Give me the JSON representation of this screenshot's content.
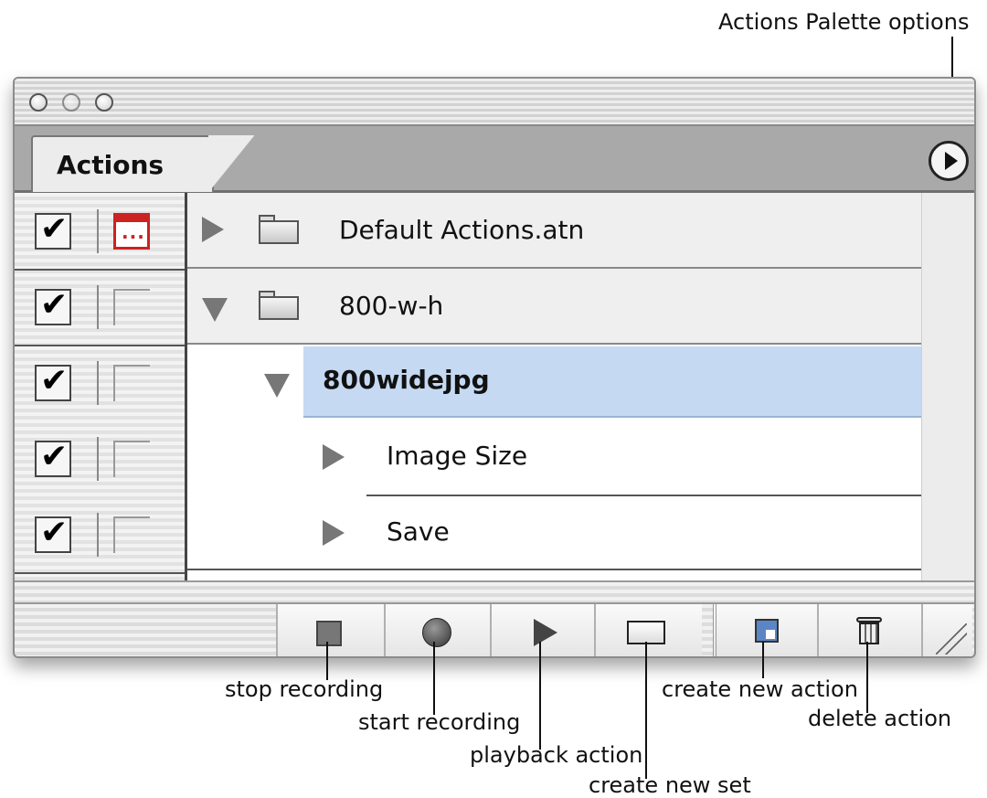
{
  "callouts": {
    "palette_options": "Actions Palette options",
    "stop_recording": "stop recording",
    "start_recording": "start recording",
    "playback_action": "playback action",
    "create_new_set": "create new set",
    "create_new_action": "create new action",
    "delete_action": "delete action"
  },
  "palette": {
    "tab_label": "Actions",
    "rows": [
      {
        "label": "Default Actions.atn",
        "type": "set",
        "expanded": false,
        "checked": true,
        "dialog": true
      },
      {
        "label": "800-w-h",
        "type": "set",
        "expanded": true,
        "checked": true,
        "dialog": false
      },
      {
        "label": "800widejpg",
        "type": "action",
        "expanded": true,
        "selected": true,
        "checked": true,
        "dialog": false
      },
      {
        "label": "Image Size",
        "type": "command",
        "expanded": false,
        "checked": true,
        "dialog": false
      },
      {
        "label": "Save",
        "type": "command",
        "expanded": false,
        "checked": true,
        "dialog": false
      }
    ],
    "dialog_glyph": "...",
    "check_glyph": "✔"
  },
  "colors": {
    "selection": "#c5d9f2",
    "dialog_toggle": "#cc2222"
  },
  "icons": [
    "stop-icon",
    "record-icon",
    "play-icon",
    "folder-icon",
    "new-action-icon",
    "trash-icon"
  ]
}
